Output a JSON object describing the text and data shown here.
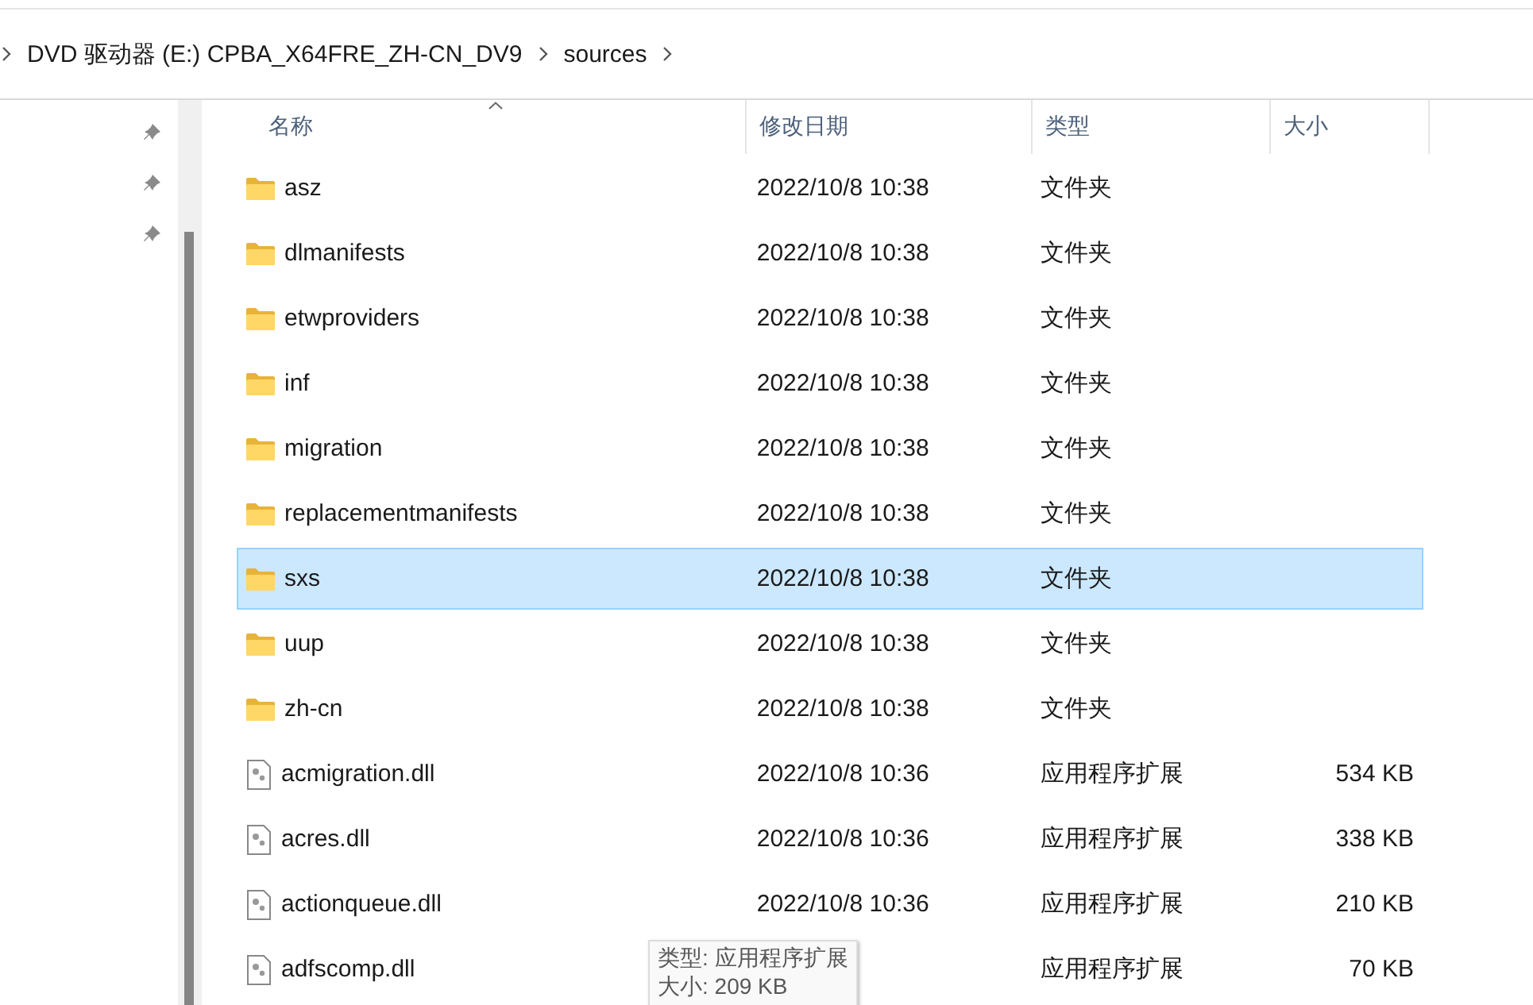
{
  "breadcrumb": [
    "DVD 驱动器 (E:) CPBA_X64FRE_ZH-CN_DV9",
    "sources"
  ],
  "columns": [
    {
      "label": "名称",
      "sorted": true
    },
    {
      "label": "修改日期"
    },
    {
      "label": "类型"
    },
    {
      "label": "大小"
    }
  ],
  "rows": [
    {
      "kind": "folder",
      "name": "asz",
      "date": "2022/10/8 10:38",
      "type": "文件夹",
      "selected": false
    },
    {
      "kind": "folder",
      "name": "dlmanifests",
      "date": "2022/10/8 10:38",
      "type": "文件夹",
      "selected": false
    },
    {
      "kind": "folder",
      "name": "etwproviders",
      "date": "2022/10/8 10:38",
      "type": "文件夹",
      "selected": false
    },
    {
      "kind": "folder",
      "name": "inf",
      "date": "2022/10/8 10:38",
      "type": "文件夹",
      "selected": false
    },
    {
      "kind": "folder",
      "name": "migration",
      "date": "2022/10/8 10:38",
      "type": "文件夹",
      "selected": false
    },
    {
      "kind": "folder",
      "name": "replacementmanifests",
      "date": "2022/10/8 10:38",
      "type": "文件夹",
      "selected": false
    },
    {
      "kind": "folder",
      "name": "sxs",
      "date": "2022/10/8 10:38",
      "type": "文件夹",
      "selected": true
    },
    {
      "kind": "folder",
      "name": "uup",
      "date": "2022/10/8 10:38",
      "type": "文件夹",
      "selected": false
    },
    {
      "kind": "folder",
      "name": "zh-cn",
      "date": "2022/10/8 10:38",
      "type": "文件夹",
      "selected": false
    },
    {
      "kind": "file",
      "name": "acmigration.dll",
      "date": "2022/10/8 10:36",
      "type": "应用程序扩展",
      "size": "534 KB",
      "selected": false
    },
    {
      "kind": "file",
      "name": "acres.dll",
      "date": "2022/10/8 10:36",
      "type": "应用程序扩展",
      "size": "338 KB",
      "selected": false
    },
    {
      "kind": "file",
      "name": "actionqueue.dll",
      "date": "2022/10/8 10:36",
      "type": "应用程序扩展",
      "size": "210 KB",
      "selected": false
    },
    {
      "kind": "file",
      "name": "adfscomp.dll",
      "type": "应用程序扩展",
      "size": "70 KB",
      "selected": false
    }
  ],
  "tooltip": [
    "类型: 应用程序扩展",
    "大小: 209 KB"
  ]
}
